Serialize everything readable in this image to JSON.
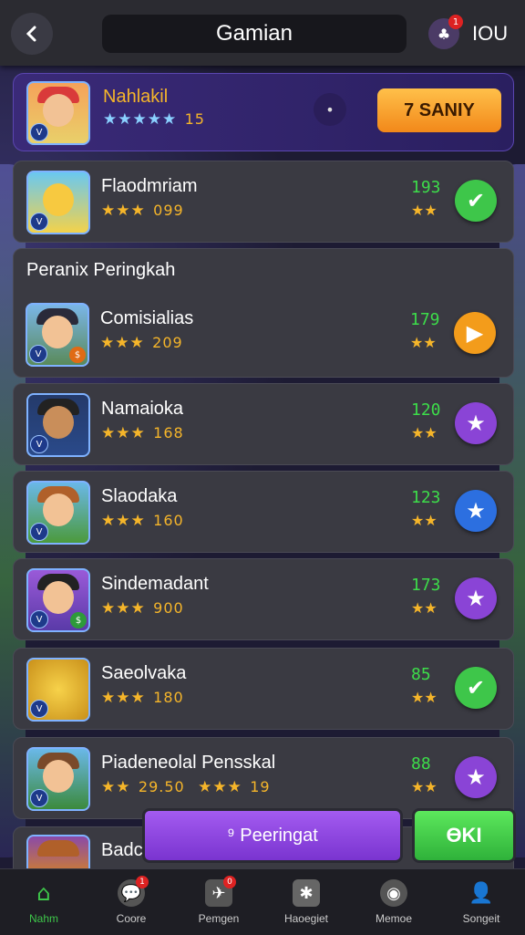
{
  "header": {
    "title": "Gamian",
    "back_icon": "back-arrow-icon",
    "profile_label": "IOU",
    "profile_badge": "1"
  },
  "featured": {
    "name": "Nahlakil",
    "stars": "★★★★★",
    "points": "15",
    "button_label": "7 SANIY",
    "dot_label": "•"
  },
  "section_title": "Peranix Peringkah",
  "rows": [
    {
      "name": "Flaodmriam",
      "stars": "★★★",
      "points": "099",
      "score": "193",
      "mini_stars": "★★",
      "action": "check",
      "color": "#3ec64a"
    },
    {
      "name": "Comisialias",
      "stars": "★★★",
      "points": "209",
      "score": "179",
      "mini_stars": "★★",
      "action": "play",
      "color": "#f39c1b"
    },
    {
      "name": "Namaioka",
      "stars": "★★★",
      "points": "168",
      "score": "120",
      "mini_stars": "★★",
      "action": "star",
      "color": "#8a44d6"
    },
    {
      "name": "Slaodaka",
      "stars": "★★★",
      "points": "160",
      "score": "123",
      "mini_stars": "★★",
      "action": "star",
      "color": "#2c6fe0"
    },
    {
      "name": "Sindemadant",
      "stars": "★★★",
      "points": "900",
      "score": "173",
      "mini_stars": "★★",
      "action": "star",
      "color": "#8a44d6"
    },
    {
      "name": "Saeolvaka",
      "stars": "★★★",
      "points": "180",
      "score": "85",
      "mini_stars": "★★",
      "action": "check",
      "color": "#3ec64a"
    },
    {
      "name": "Piadeneolal Pensskal",
      "stars": "★★",
      "points": "29.50",
      "stars2": "★★★",
      "points2": "19",
      "score": "88",
      "mini_stars": "★★",
      "action": "star",
      "color": "#8a44d6"
    },
    {
      "name": "Badc"
    }
  ],
  "bottom_buttons": {
    "primary": "⁹ Peeringat",
    "secondary": "ƟKI"
  },
  "nav": [
    {
      "label": "Nahm",
      "icon": "home-icon",
      "badge": ""
    },
    {
      "label": "Coore",
      "icon": "chat-icon",
      "badge": "1"
    },
    {
      "label": "Pemgen",
      "icon": "send-icon",
      "badge": "0"
    },
    {
      "label": "Haoegiet",
      "icon": "puzzle-icon",
      "badge": ""
    },
    {
      "label": "Memoe",
      "icon": "target-icon",
      "badge": ""
    },
    {
      "label": "Songeit",
      "icon": "person-icon",
      "badge": ""
    }
  ],
  "colors": {
    "accent": "#f39c1b",
    "green": "#3ec64a",
    "purple": "#8a44d6",
    "panel": "#3a3a42"
  }
}
